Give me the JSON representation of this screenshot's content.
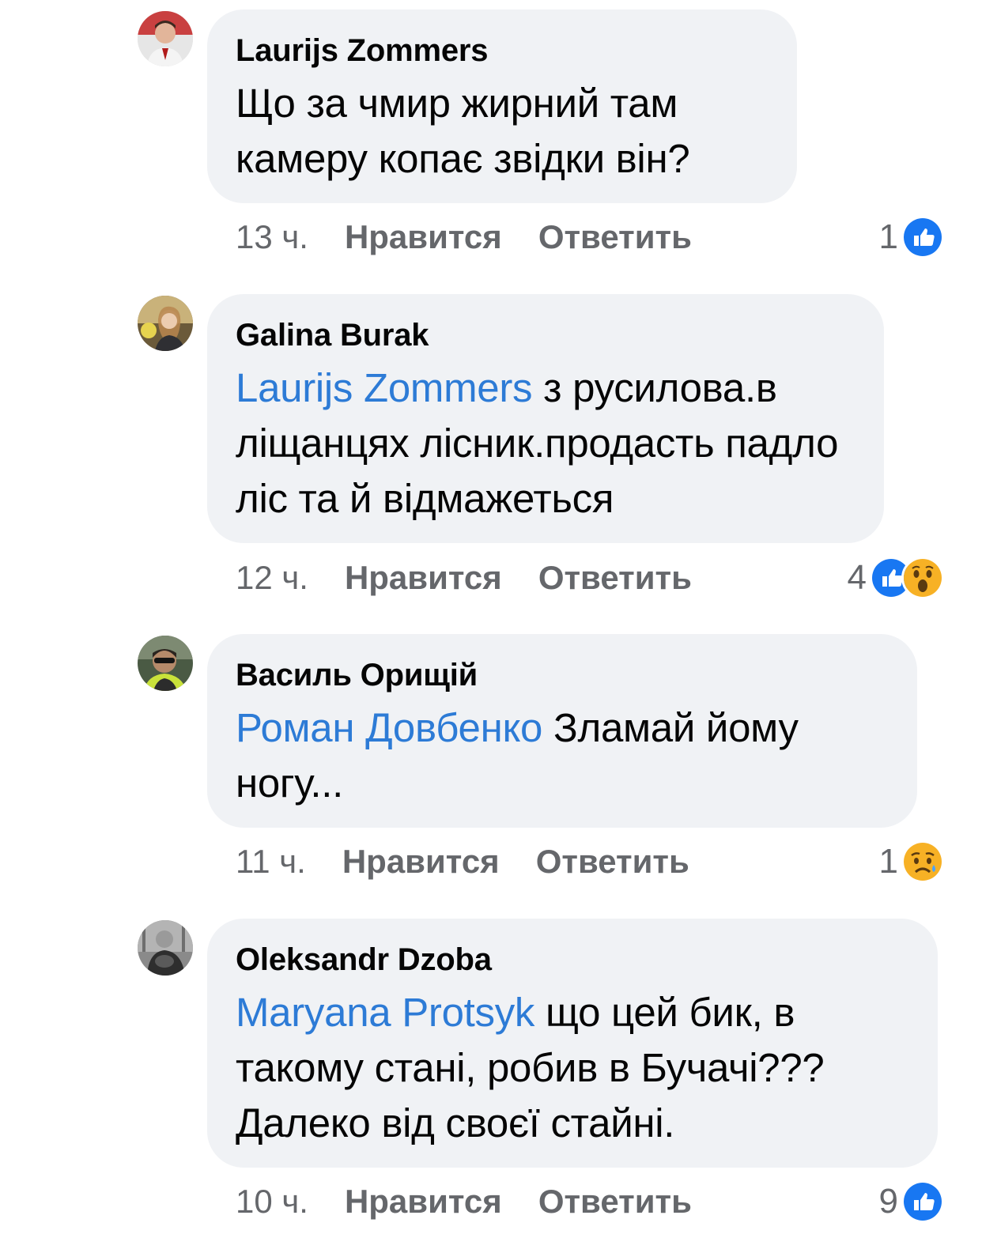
{
  "comments": [
    {
      "author": "Laurijs Zommers",
      "mention": "",
      "text": "Що за чмир  жирний там камеру копає звідки він?",
      "time": "13 ч.",
      "like_label": "Нравится",
      "reply_label": "Ответить",
      "reaction_count": "1",
      "reactions": [
        "like"
      ]
    },
    {
      "author": "Galina Burak",
      "mention": "Laurijs Zommers",
      "text": " з русилова.в ліщанцях лісник.продасть падло ліс та й відмажеться",
      "time": "12 ч.",
      "like_label": "Нравится",
      "reply_label": "Ответить",
      "reaction_count": "4",
      "reactions": [
        "like",
        "wow"
      ]
    },
    {
      "author": "Василь Орищій",
      "mention": "Роман Довбенко",
      "text": " Зламай йому ногу...",
      "time": "11 ч.",
      "like_label": "Нравится",
      "reply_label": "Ответить",
      "reaction_count": "1",
      "reactions": [
        "sad"
      ]
    },
    {
      "author": "Oleksandr Dzoba",
      "mention": "Maryana Protsyk",
      "text": " що цей бик, в такому стані, робив в Бучачі??? Далеко від своєї стайні.",
      "time": "10 ч.",
      "like_label": "Нравится",
      "reply_label": "Ответить",
      "reaction_count": "9",
      "reactions": [
        "like"
      ]
    }
  ],
  "colors": {
    "bubble": "#f0f2f5",
    "mention": "#2d7bd6",
    "meta": "#65676b",
    "like": "#1877f2",
    "emoji": "#f7b125"
  }
}
